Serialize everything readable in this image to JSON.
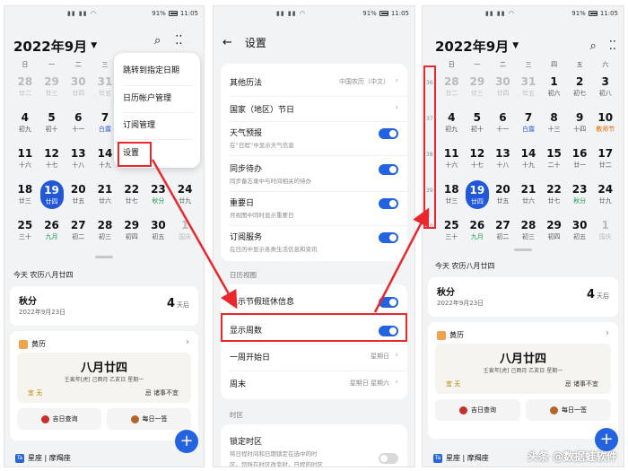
{
  "status": {
    "signal": "▮▮ ▮▮ ◠",
    "battery": "91%",
    "time": "11:05"
  },
  "colors": {
    "accent": "#2463e0",
    "highlight": "#e8282d",
    "today": "#2258d8"
  },
  "calendar": {
    "title": "2022年9月",
    "weekdays": [
      "日",
      "一",
      "二",
      "三",
      "四",
      "五",
      "六"
    ],
    "rows": [
      [
        {
          "n": "28",
          "s": "廿二",
          "c": "dim"
        },
        {
          "n": "29",
          "s": "廿三",
          "c": "dim"
        },
        {
          "n": "30",
          "s": "廿四",
          "c": "dim"
        },
        {
          "n": "31",
          "s": "廿五",
          "c": "dim"
        },
        {
          "n": "1",
          "s": "初六"
        },
        {
          "n": "2",
          "s": "初七"
        },
        {
          "n": "3",
          "s": "初八"
        }
      ],
      [
        {
          "n": "4",
          "s": "初九"
        },
        {
          "n": "5",
          "s": "初十"
        },
        {
          "n": "6",
          "s": "十一"
        },
        {
          "n": "7",
          "s": "白露",
          "c": "blue"
        },
        {
          "n": "8",
          "s": "十三"
        },
        {
          "n": "9",
          "s": "十四"
        },
        {
          "n": "10",
          "s": "教师节",
          "c": "orange"
        }
      ],
      [
        {
          "n": "11",
          "s": "十六"
        },
        {
          "n": "12",
          "s": "十七"
        },
        {
          "n": "13",
          "s": "十八"
        },
        {
          "n": "14",
          "s": "十九"
        },
        {
          "n": "15",
          "s": "二十"
        },
        {
          "n": "16",
          "s": "廿一"
        },
        {
          "n": "17",
          "s": "廿二"
        }
      ],
      [
        {
          "n": "18",
          "s": "廿三"
        },
        {
          "n": "19",
          "s": "廿四",
          "c": "today"
        },
        {
          "n": "20",
          "s": "廿五"
        },
        {
          "n": "21",
          "s": "廿六"
        },
        {
          "n": "22",
          "s": "廿七"
        },
        {
          "n": "23",
          "s": "秋分",
          "c": "green"
        },
        {
          "n": "24",
          "s": "廿九"
        }
      ],
      [
        {
          "n": "25",
          "s": "三十"
        },
        {
          "n": "26",
          "s": "九月",
          "c": "green"
        },
        {
          "n": "27",
          "s": "初二"
        },
        {
          "n": "28",
          "s": "初三"
        },
        {
          "n": "29",
          "s": "初四"
        },
        {
          "n": "30",
          "s": "初五"
        },
        {
          "n": "1",
          "s": "国庆",
          "c": "dim"
        }
      ]
    ]
  },
  "today_label": "今天 农历八月廿四",
  "event": {
    "title": "秋分",
    "date": "2022年9月23日",
    "days_num": "4",
    "days_unit": "天后"
  },
  "almanac": {
    "label": "黄历",
    "lunar": "八月廿四",
    "ganzhi": "壬寅年[虎]  己酉月  乙亥日  星期一",
    "yi": "宜  无",
    "ji": "忌  诸事不宜",
    "btn1": "吉日查询",
    "btn2": "每日一签"
  },
  "constellation": {
    "icon": "Ta",
    "text": "星座 | 摩羯座"
  },
  "fab": "+",
  "menu": {
    "items": [
      "跳转到指定日期",
      "日历帐户管理",
      "订阅管理",
      "设置"
    ]
  },
  "settings": {
    "title": "设置",
    "other_cal": {
      "label": "其他历法",
      "value": "中国农历（中文）"
    },
    "holidays": {
      "label": "国家（地区）节日"
    },
    "weather": {
      "label": "天气预报",
      "sub": "在“日程”中显示天气信息"
    },
    "todo": {
      "label": "同步待办",
      "sub": "同步备忘录中与时间相关的待办"
    },
    "important": {
      "label": "重要日",
      "sub": "月视图中同时显示重要日"
    },
    "subscribe": {
      "label": "订阅服务",
      "sub": "在日历中显示各类生活信息和资讯"
    },
    "view_section": "日历视图",
    "rest_info": {
      "label": "显示节假班休信息"
    },
    "week_num": {
      "label": "显示周数"
    },
    "week_start": {
      "label": "一周开始日",
      "value": "星期日"
    },
    "weekend": {
      "label": "周末",
      "value": "星期日 星期六"
    },
    "tz_section": "时区",
    "lock_tz": {
      "label": "锁定时区",
      "sub1": "将日程时间和日期锁定在选中的时",
      "sub2": "区。您所在时区改变时，日程的时区"
    }
  },
  "week_numbers": [
    "36",
    "37",
    "38",
    "39",
    "40"
  ],
  "watermark": "头条 @数据蛙软件"
}
